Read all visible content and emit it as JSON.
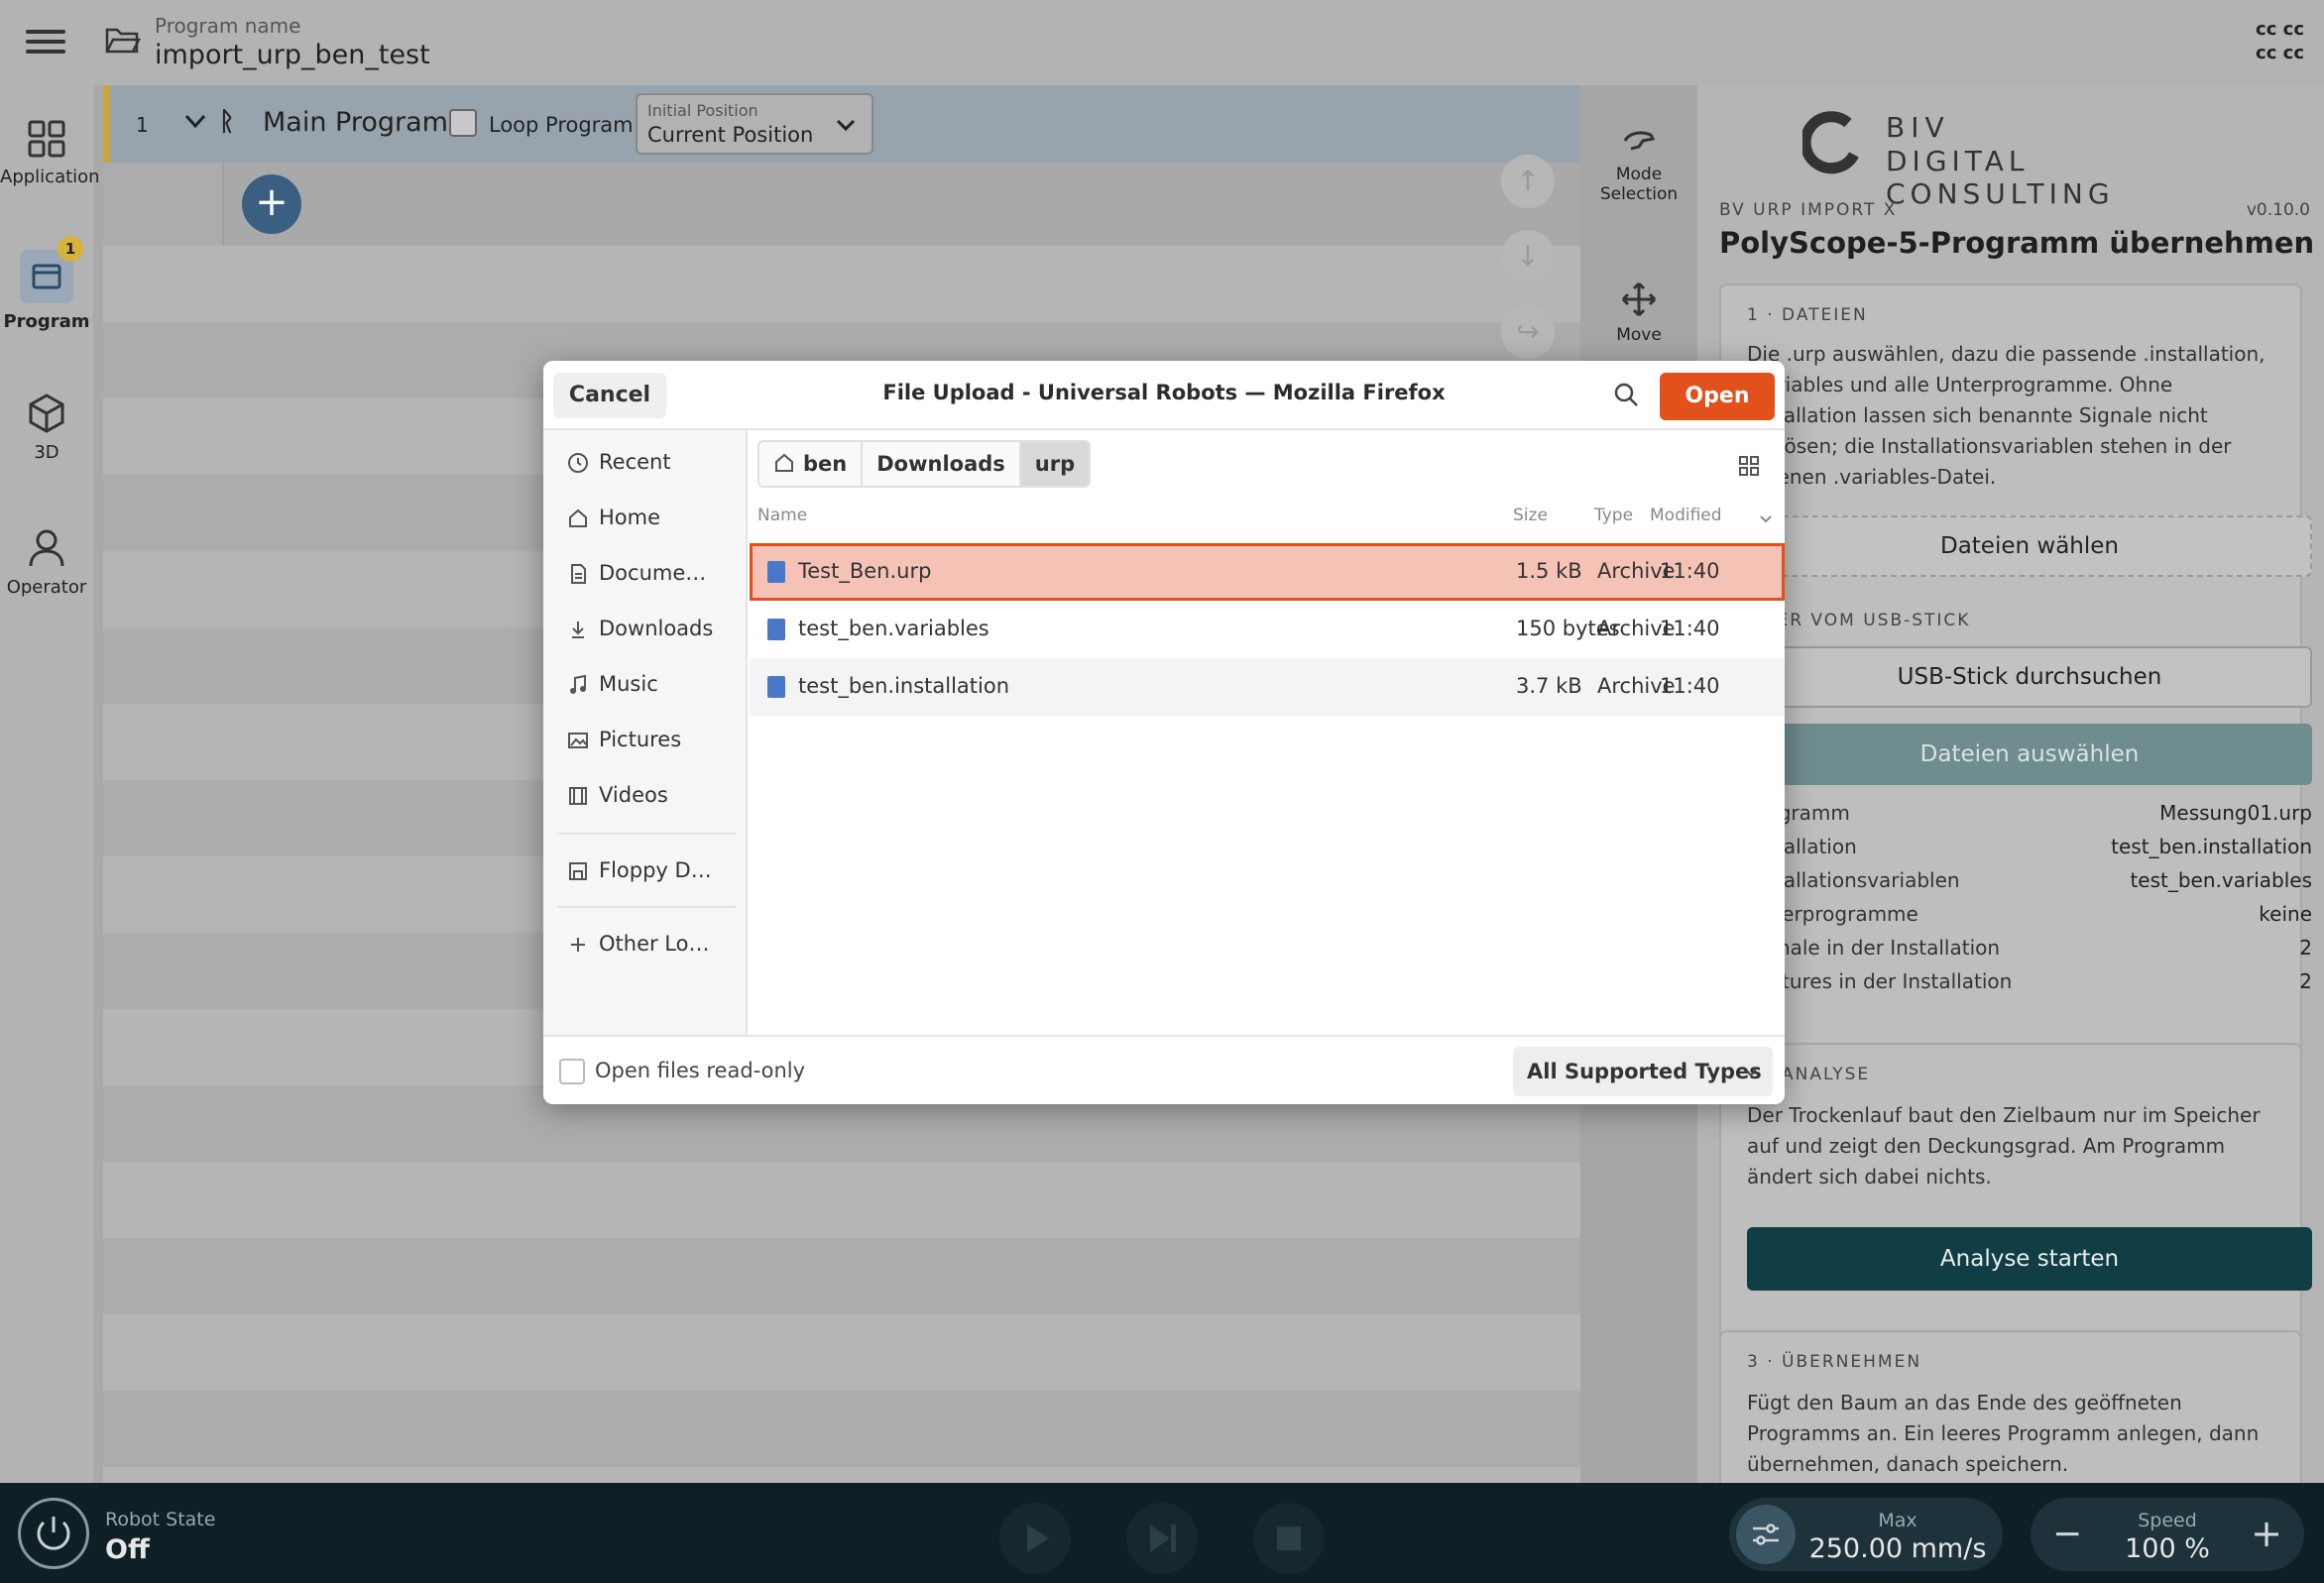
{
  "header": {
    "program_label": "Program name",
    "program_name": "import_urp_ben_test",
    "corner_text_1": "cc cc",
    "corner_text_2": "cc cc"
  },
  "sidebar": {
    "items": [
      {
        "label": "Application",
        "icon": "grid-icon"
      },
      {
        "label": "Program",
        "icon": "program-icon",
        "badge": "1"
      },
      {
        "label": "3D",
        "icon": "cube-icon"
      },
      {
        "label": "Operator",
        "icon": "person-icon"
      }
    ]
  },
  "tree": {
    "line_number": "1",
    "main_label": "Main Program",
    "loop_label": "Loop Program",
    "initial_position_label": "Initial Position",
    "initial_position_value": "Current Position"
  },
  "tools": {
    "mode_selection_line1": "Mode",
    "mode_selection_line2": "Selection",
    "move_label": "Move"
  },
  "panel": {
    "logo_line1": "BIV",
    "logo_line2": "DIGITAL CONSULTING",
    "kicker": "BV URP IMPORT X",
    "version": "v0.10.0",
    "title": "PolyScope-5-Programm übernehmen",
    "section1": {
      "title": "1 · DATEIEN",
      "text": "Die .urp auswählen, dazu die passende .installation, .variables und alle Unterprogramme. Ohne Installation lassen sich benannte Signale nicht auflösen; die Installationsvariablen stehen in der eigenen .variables-Datei.",
      "choose_button": "Dateien wählen",
      "usb_title": "ODER VOM USB-STICK",
      "usb_button": "USB-Stick durchsuchen",
      "select_button": "Dateien auswählen",
      "rows": [
        {
          "key": "Programm",
          "value": "Messung01.urp"
        },
        {
          "key": "Installation",
          "value": "test_ben.installation"
        },
        {
          "key": "Installationsvariablen",
          "value": "test_ben.variables"
        },
        {
          "key": "Unterprogramme",
          "value": "keine"
        },
        {
          "key": "Signale in der Installation",
          "value": "2"
        },
        {
          "key": "Features in der Installation",
          "value": "2"
        }
      ]
    },
    "section2": {
      "title": "2 · ANALYSE",
      "text": "Der Trockenlauf baut den Zielbaum nur im Speicher auf und zeigt den Deckungsgrad. Am Programm ändert sich dabei nichts.",
      "button": "Analyse starten"
    },
    "section3": {
      "title": "3 · ÜBERNEHMEN",
      "text": "Fügt den Baum an das Ende des geöffneten Programms an. Ein leeres Programm anlegen, dann übernehmen, danach speichern."
    }
  },
  "bottom": {
    "robot_state_label": "Robot State",
    "robot_state_value": "Off",
    "max_label": "Max",
    "max_value": "250.00 mm/s",
    "speed_label": "Speed",
    "speed_value": "100 %"
  },
  "dialog": {
    "cancel": "Cancel",
    "title": "File Upload - Universal Robots — Mozilla Firefox",
    "open": "Open",
    "places": [
      {
        "label": "Recent",
        "icon": "clock-icon"
      },
      {
        "label": "Home",
        "icon": "home-icon"
      },
      {
        "label": "Docume…",
        "icon": "document-icon"
      },
      {
        "label": "Downloads",
        "icon": "download-icon"
      },
      {
        "label": "Music",
        "icon": "music-icon"
      },
      {
        "label": "Pictures",
        "icon": "picture-icon"
      },
      {
        "label": "Videos",
        "icon": "video-icon"
      },
      {
        "label": "Floppy D…",
        "icon": "floppy-icon"
      },
      {
        "label": "Other Lo…",
        "icon": "plus-icon"
      }
    ],
    "breadcrumb": [
      "ben",
      "Downloads",
      "urp"
    ],
    "columns": {
      "name": "Name",
      "size": "Size",
      "type": "Type",
      "modified": "Modified"
    },
    "files": [
      {
        "name": "Test_Ben.urp",
        "size": "1.5 kB",
        "type": "Archive",
        "modified": "11:40",
        "selected": true
      },
      {
        "name": "test_ben.variables",
        "size": "150 bytes",
        "type": "Archive",
        "modified": "11:40"
      },
      {
        "name": "test_ben.installation",
        "size": "3.7 kB",
        "type": "Archive",
        "modified": "11:40"
      }
    ],
    "readonly_label": "Open files read-only",
    "filter": "All Supported Types"
  },
  "colors": {
    "accent_orange": "#e2501c",
    "dark_teal": "#113e44",
    "add_button_blue": "#3a5f80"
  }
}
